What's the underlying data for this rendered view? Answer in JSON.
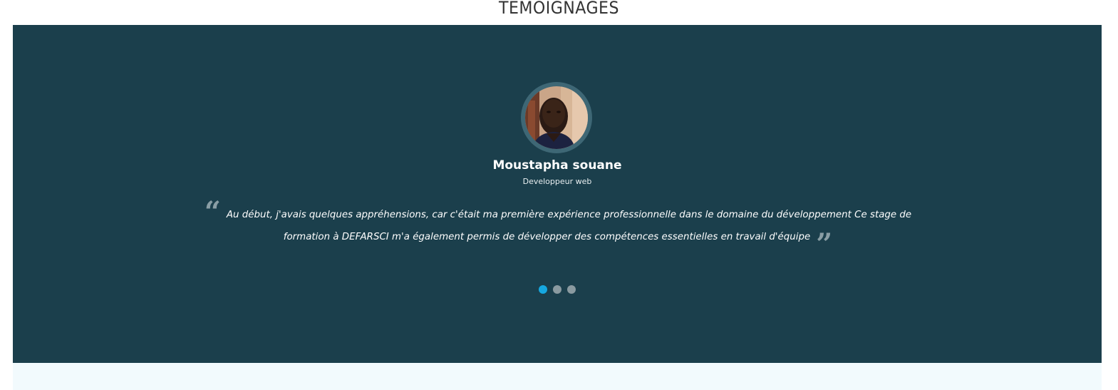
{
  "section": {
    "title": "TEMOIGNAGES"
  },
  "testimonial": {
    "name": "Moustapha souane",
    "role": "Developpeur web",
    "quote": "Au début, j'avais quelques appréhensions, car c'était ma première expérience professionnelle dans le domaine du développement Ce stage de formation à DEFARSCI m'a également permis de développer des compétences essentielles en travail d'équipe",
    "avatar_icon": "person-photo"
  },
  "pagination": {
    "active_index": 0,
    "count": 3,
    "active_color": "#16a8e0",
    "inactive_color": "#8a9aa0"
  },
  "colors": {
    "slider_background": "#1b3f4c",
    "avatar_ring": "#3e6775",
    "quote_mark": "#8a9ea5",
    "bottom_band": "#f2fafd"
  }
}
